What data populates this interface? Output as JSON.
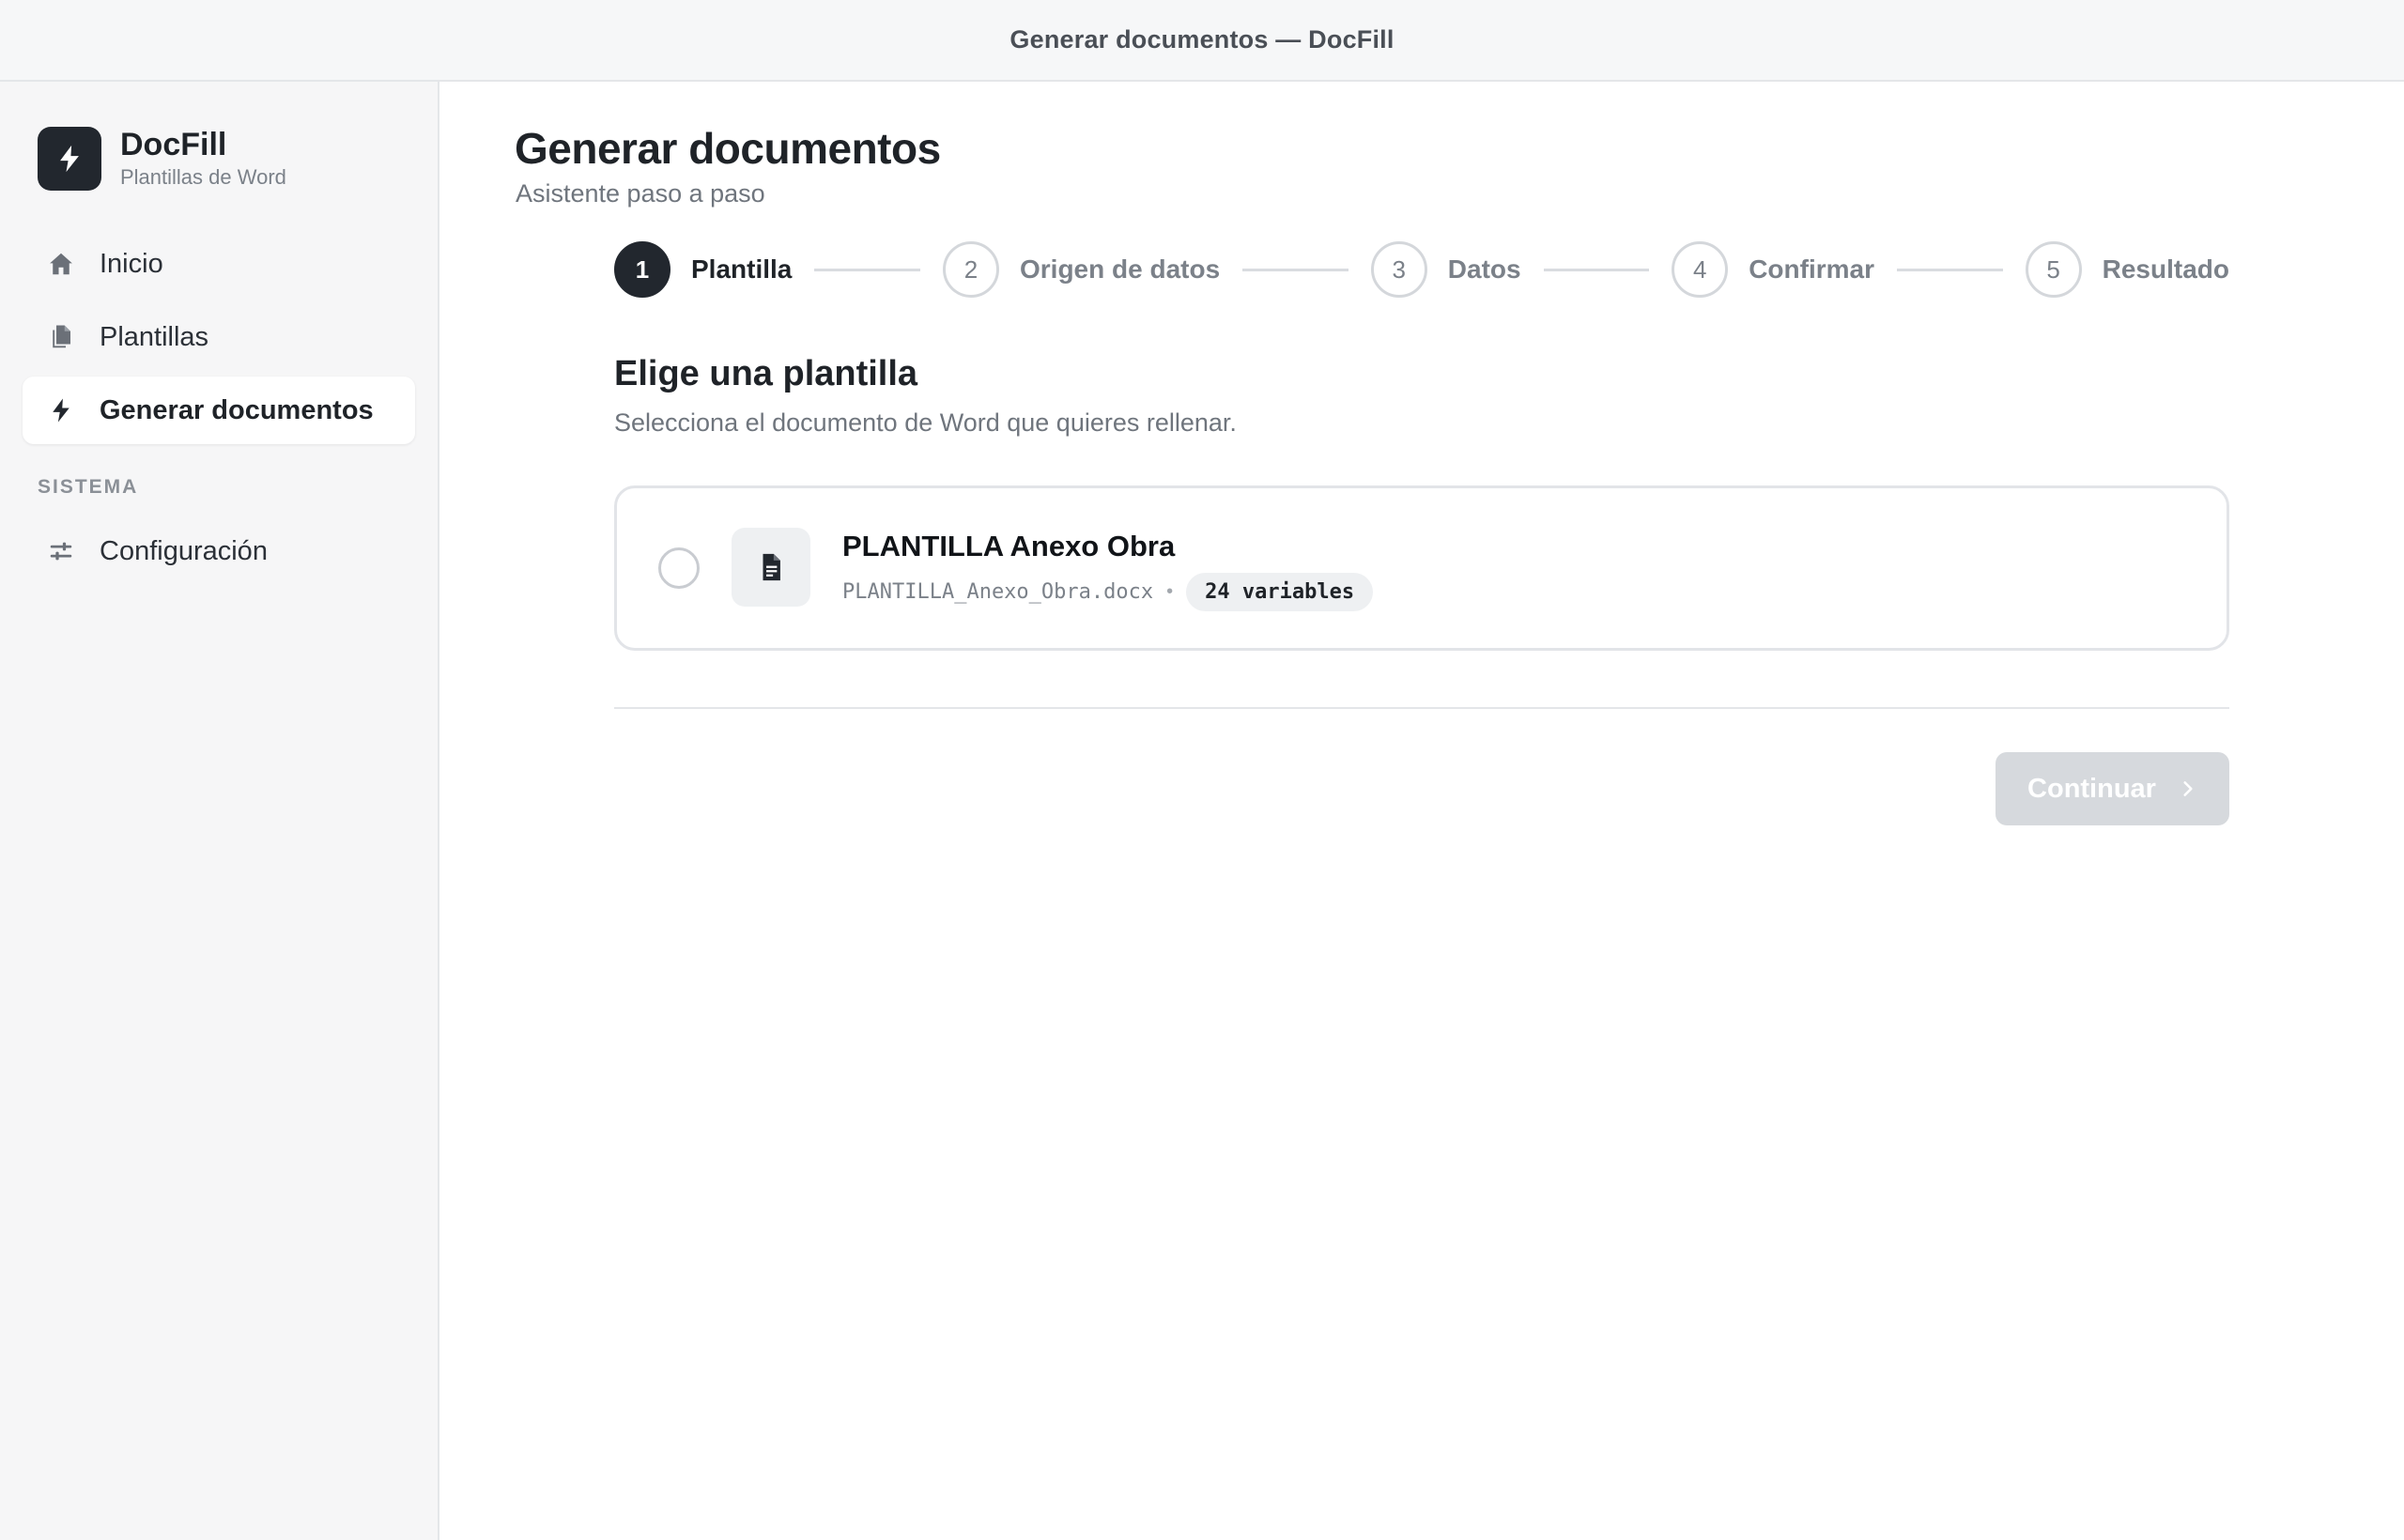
{
  "window": {
    "title": "Generar documentos — DocFill"
  },
  "sidebar": {
    "brand": {
      "name": "DocFill",
      "subtitle": "Plantillas de Word",
      "icon": "bolt-icon"
    },
    "items": [
      {
        "label": "Inicio",
        "icon": "home-icon",
        "active": false
      },
      {
        "label": "Plantillas",
        "icon": "documents-icon",
        "active": false
      },
      {
        "label": "Generar documentos",
        "icon": "bolt-icon",
        "active": true
      }
    ],
    "section_label": "SISTEMA",
    "system_items": [
      {
        "label": "Configuración",
        "icon": "sliders-icon",
        "active": false
      }
    ]
  },
  "main": {
    "title": "Generar documentos",
    "subtitle": "Asistente paso a paso",
    "steps": [
      {
        "number": "1",
        "label": "Plantilla",
        "active": true
      },
      {
        "number": "2",
        "label": "Origen de datos",
        "active": false
      },
      {
        "number": "3",
        "label": "Datos",
        "active": false
      },
      {
        "number": "4",
        "label": "Confirmar",
        "active": false
      },
      {
        "number": "5",
        "label": "Resultado",
        "active": false
      }
    ],
    "section_title": "Elige una plantilla",
    "section_description": "Selecciona el documento de Word que quieres rellenar.",
    "templates": [
      {
        "name": "PLANTILLA Anexo Obra",
        "filename": "PLANTILLA_Anexo_Obra.docx",
        "separator": "•",
        "variables": "24 variables",
        "selected": false,
        "icon": "file-icon"
      }
    ],
    "continue_label": "Continuar",
    "continue_enabled": false
  },
  "colors": {
    "accent_dark": "#22272e",
    "sidebar_bg": "#f6f6f7",
    "button_disabled": "#d6d9dd",
    "muted_text": "#6f757d"
  }
}
